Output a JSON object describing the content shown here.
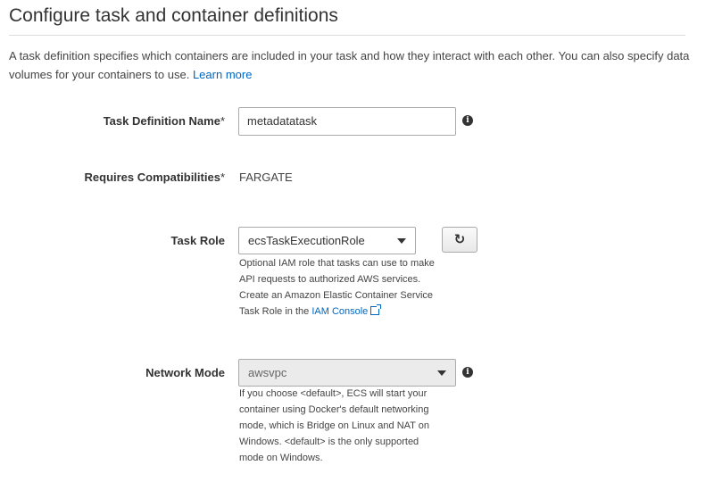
{
  "page": {
    "title": "Configure task and container definitions",
    "description": "A task definition specifies which containers are included in your task and how they interact with each other. You can also specify data volumes for your containers to use.",
    "learn_more": "Learn more"
  },
  "fields": {
    "task_definition_name": {
      "label": "Task Definition Name",
      "required_mark": "*",
      "value": "metadatatask"
    },
    "requires_compatibilities": {
      "label": "Requires Compatibilities",
      "required_mark": "*",
      "value": "FARGATE"
    },
    "task_role": {
      "label": "Task Role",
      "value": "ecsTaskExecutionRole",
      "refresh_icon": "refresh-icon",
      "help_line1": "Optional IAM role that tasks can use to make",
      "help_line2": "API requests to authorized AWS services.",
      "help_line3": "Create an Amazon Elastic Container Service",
      "help_line4_prefix": "Task Role in the",
      "help_link": "IAM Console"
    },
    "network_mode": {
      "label": "Network Mode",
      "value": "awsvpc",
      "help_line1": "If you choose <default>, ECS will start your",
      "help_line2": "container using Docker's default networking",
      "help_line3": "mode, which is Bridge on Linux and NAT on",
      "help_line4": "Windows. <default> is the only supported",
      "help_line5": "mode on Windows."
    }
  },
  "icons": {
    "info": "info-icon",
    "dropdown": "chevron-down-icon",
    "external": "external-link-icon"
  },
  "colors": {
    "link": "#0066c0",
    "disabled_bg": "#ebebeb"
  }
}
